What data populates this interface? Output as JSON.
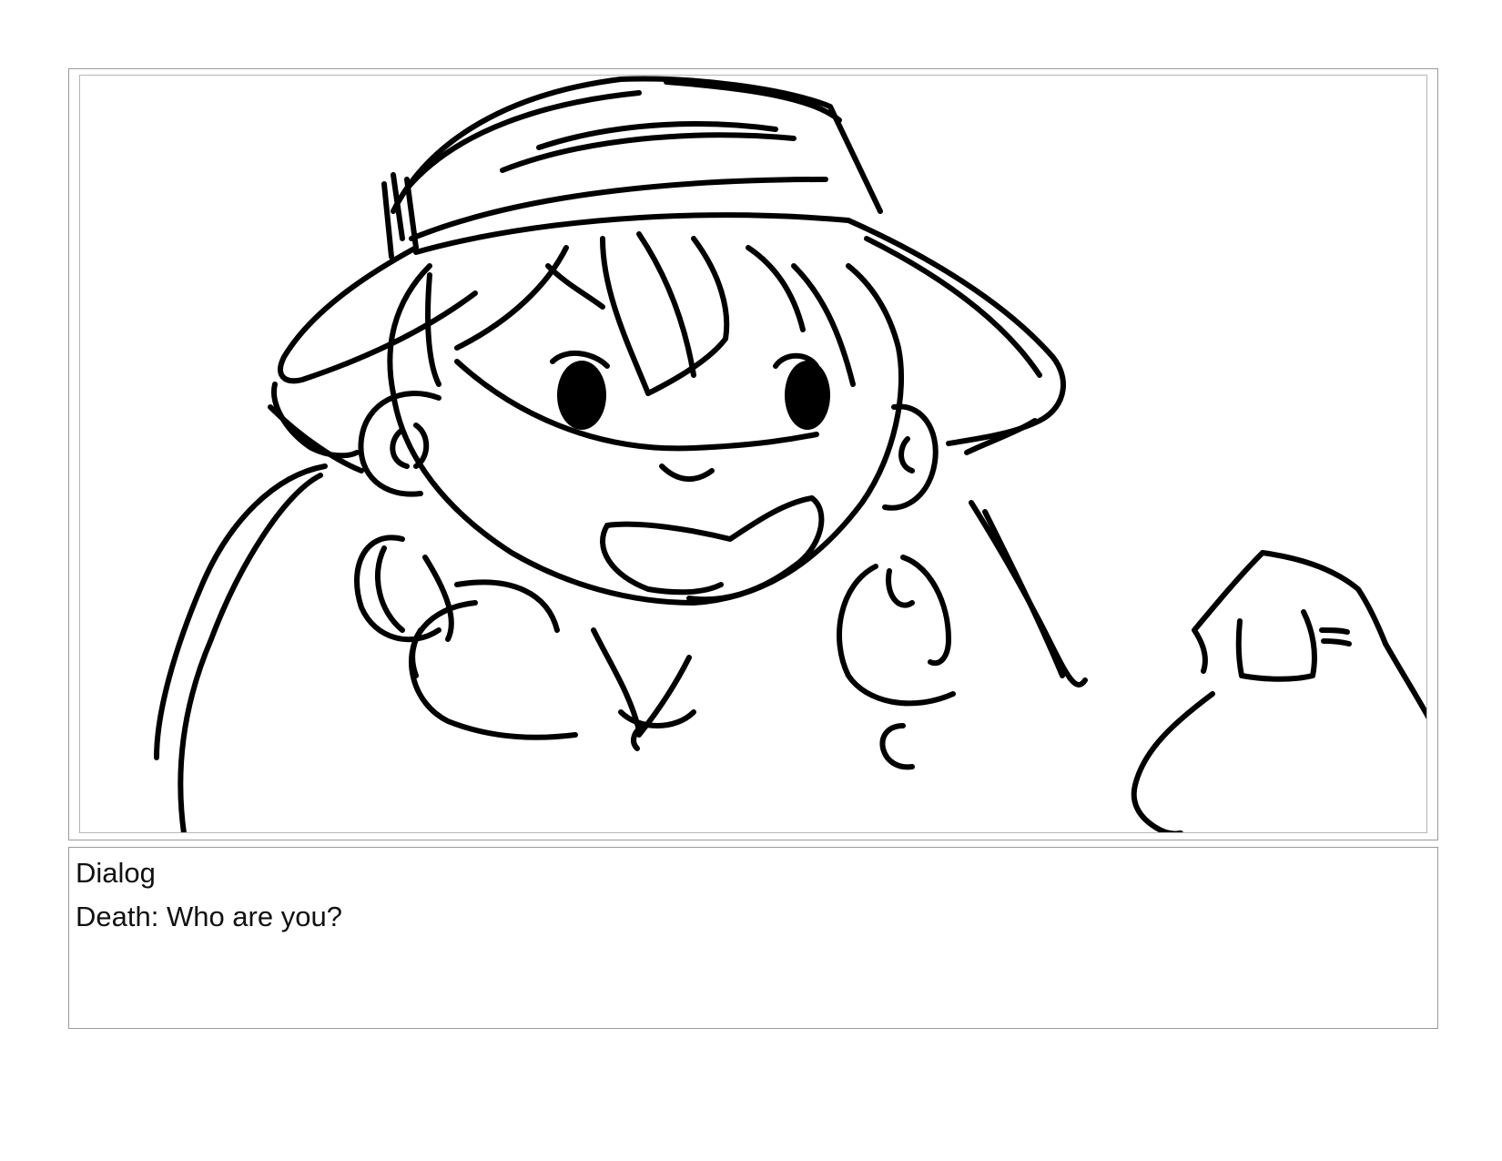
{
  "panel": {
    "dialog_heading": "Dialog",
    "dialog_text": "Death: Who are you?"
  }
}
